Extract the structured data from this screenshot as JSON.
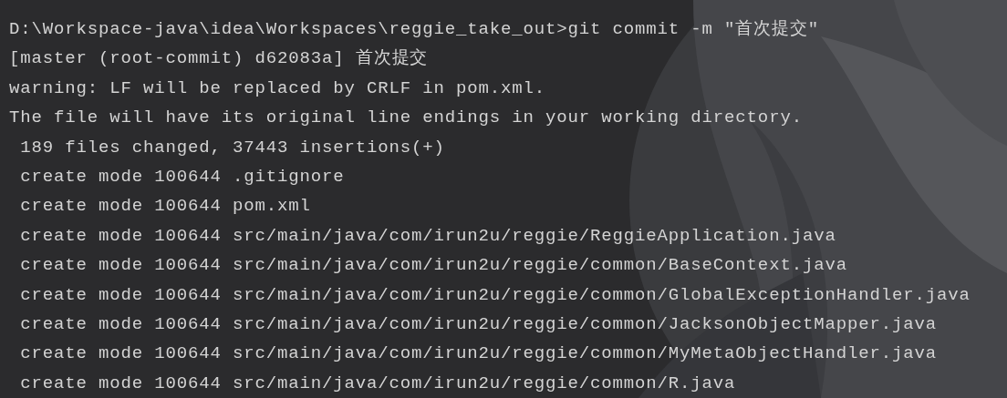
{
  "terminal": {
    "lines": [
      "D:\\Workspace-java\\idea\\Workspaces\\reggie_take_out>git commit -m ″首次提交″",
      "[master (root-commit) d62083a] 首次提交",
      "warning: LF will be replaced by CRLF in pom.xml.",
      "The file will have its original line endings in your working directory.",
      " 189 files changed, 37443 insertions(+)",
      " create mode 100644 .gitignore",
      " create mode 100644 pom.xml",
      " create mode 100644 src/main/java/com/irun2u/reggie/ReggieApplication.java",
      " create mode 100644 src/main/java/com/irun2u/reggie/common/BaseContext.java",
      " create mode 100644 src/main/java/com/irun2u/reggie/common/GlobalExceptionHandler.java",
      " create mode 100644 src/main/java/com/irun2u/reggie/common/JacksonObjectMapper.java",
      " create mode 100644 src/main/java/com/irun2u/reggie/common/MyMetaObjectHandler.java",
      " create mode 100644 src/main/java/com/irun2u/reggie/common/R.java"
    ]
  }
}
